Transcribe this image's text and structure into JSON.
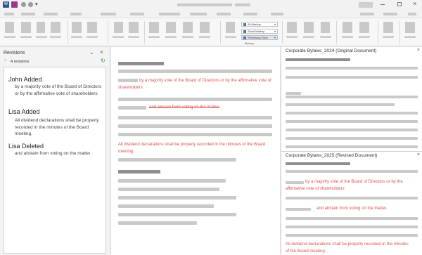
{
  "ribbon": {
    "markup_group_label": "Markup",
    "markup_options": [
      {
        "label": "All Markup"
      },
      {
        "label": "Show Markup"
      },
      {
        "label": "Reviewing Pane"
      }
    ]
  },
  "revisions_panel": {
    "title": "Revisions",
    "count_label": "4 revisions",
    "items": [
      {
        "author": "John Added",
        "text": "by a majority vote of the Board of Directors or by the affirmative vote of shareholders"
      },
      {
        "author": "Lisa Added",
        "text": "All dividend declarations shall be properly recorded in the minutes of the Board meeting."
      },
      {
        "author": "Lisa Deleted",
        "text": "and abstain from voting on the matter."
      }
    ]
  },
  "document": {
    "added_john": "by a majority vote of the Board of Directors or by the affirmative vote of shareholders",
    "deleted_lisa": "and abstain from voting on the matter.",
    "added_lisa": "All dividend declarations shall be properly recorded in the minutes of the Board meeting."
  },
  "original_pane": {
    "title": "Corporate Bylaws_2024 (Original Document)"
  },
  "revised_pane": {
    "title": "Corporate Bylaws_2025 (Revised Document)",
    "text_john": "by a majority vote of the Board of Directors or by the affirmative vote of shareholders",
    "text_abstain": "and abstain from voting on the matter.",
    "text_lisa": "All dividend declarations shall be properly recorded in the minutes of the Board meeting."
  },
  "colors": {
    "accent_blue": "#2b579a",
    "revision_red": "#d9534f",
    "save_purple": "#a0358f"
  },
  "icons": [
    "word-app-icon",
    "save-icon",
    "undo-icon",
    "redo-icon",
    "customize-icon",
    "minimize-icon",
    "maximize-icon",
    "close-icon",
    "chevron-down-icon",
    "refresh-icon"
  ]
}
